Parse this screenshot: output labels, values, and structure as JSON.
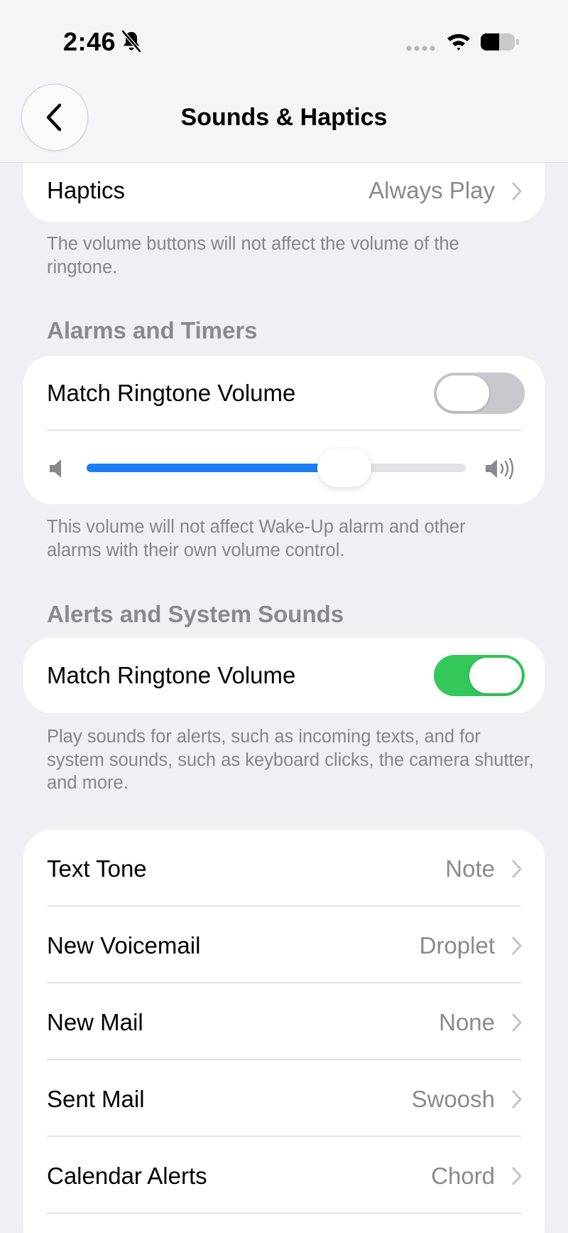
{
  "status_bar": {
    "time": "2:46"
  },
  "nav": {
    "title": "Sounds & Haptics",
    "back_icon": "chevron-left-icon"
  },
  "haptics": {
    "label": "Haptics",
    "value": "Always Play"
  },
  "ringer_note": "The volume buttons will not affect the volume of the ringtone.",
  "alarms": {
    "section_title": "Alarms and Timers",
    "match_label": "Match Ringtone Volume",
    "match_on": false,
    "volume_level": 0.68,
    "note": "This volume will not affect Wake-Up alarm and other alarms with their own volume control."
  },
  "alerts": {
    "section_title": "Alerts and System Sounds",
    "match_label": "Match Ringtone Volume",
    "match_on": true,
    "note": "Play sounds for alerts, such as incoming texts, and for system sounds, such as keyboard clicks, the camera shutter, and more."
  },
  "tones": [
    {
      "label": "Text Tone",
      "value": "Note"
    },
    {
      "label": "New Voicemail",
      "value": "Droplet"
    },
    {
      "label": "New Mail",
      "value": "None"
    },
    {
      "label": "Sent Mail",
      "value": "Swoosh"
    },
    {
      "label": "Calendar Alerts",
      "value": "Chord"
    }
  ],
  "colors": {
    "accent": "#1a7ef7",
    "toggle_on": "#34c759",
    "toggle_off": "#c8c8cc"
  }
}
